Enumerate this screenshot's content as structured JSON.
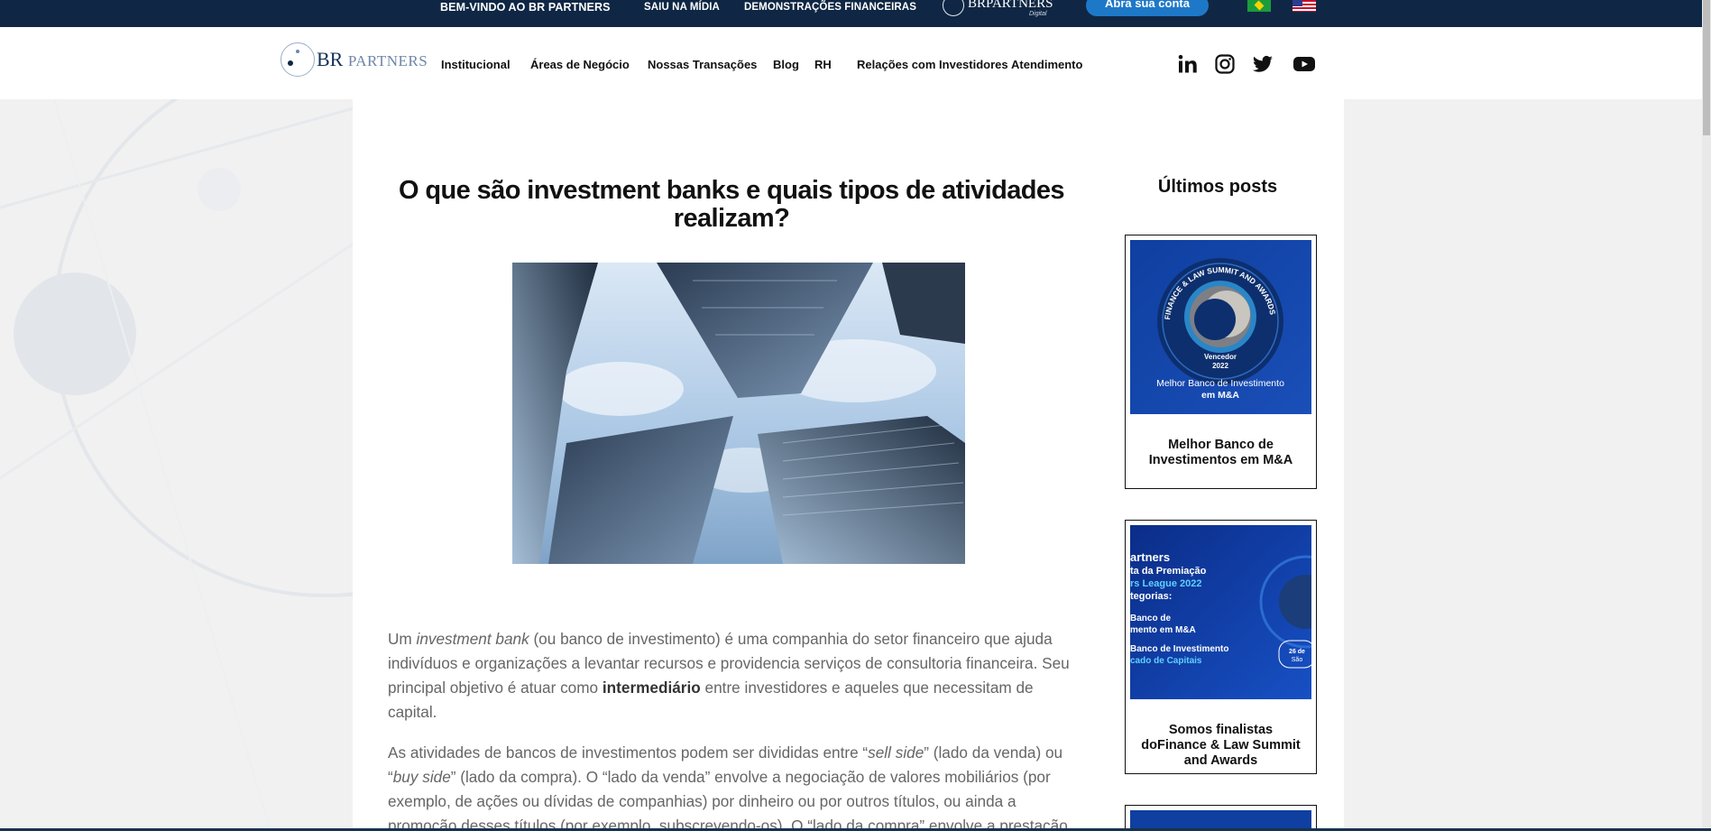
{
  "topbar": {
    "welcome": "BEM-VINDO AO BR PARTNERS",
    "midia": "SAIU NA MÍDIA",
    "demonstracoes": "DEMONSTRAÇÕES FINANCEIRAS",
    "digital_logo": "BRPARTNERS",
    "digital_sub": "Digital",
    "account_button": "Abra sua conta",
    "flag_br": "flag-brazil-icon",
    "flag_us": "flag-usa-icon"
  },
  "header": {
    "logo_main": "BR",
    "logo_rest": "PARTNERS",
    "nav": [
      "Institucional",
      "Áreas de Negócio",
      "Nossas Transações",
      "Blog",
      "RH",
      "Relações com Investidores",
      "Atendimento"
    ],
    "social": [
      "linkedin-icon",
      "instagram-icon",
      "twitter-icon",
      "youtube-icon"
    ]
  },
  "article": {
    "title": "O que são investment banks e quais tipos de atividades realizam?",
    "p1": {
      "a": "Um ",
      "b": "investment bank",
      "c": " (ou banco de investimento) é uma companhia do setor financeiro que ajuda indivíduos e organizações a levantar recursos e providencia serviços de consultoria financeira. Seu principal objetivo é atuar como ",
      "d": "intermediário",
      "e": " entre investidores e aqueles que necessitam de capital."
    },
    "p2": {
      "a": "As atividades de bancos de investimentos podem ser divididas entre “",
      "b": "sell side",
      "c": "” (lado da venda) ou “",
      "d": "buy side",
      "e": "” (lado da compra). O “lado da venda” envolve a negociação de valores mobiliários (por exemplo, de ações ou dívidas de companhias) por dinheiro ou por outros títulos, ou ainda a promoção desses títulos (por exemplo, subscrevendo-os). O “lado da compra” envolve a prestação"
    }
  },
  "sidebar": {
    "title": "Últimos posts",
    "posts": [
      {
        "title": "Melhor Banco de Investimentos em M&A",
        "badge_ring": "FINANCE & LAW SUMMIT AND AWARDS",
        "badge_winner": "Vencedor",
        "badge_year": "2022",
        "badge_line1": "Melhor Banco de Investimento",
        "badge_line2": "em M&A"
      },
      {
        "title": "Somos finalistas doFinance & Law Summit and Awards",
        "img_lines": [
          "artners",
          "ta da Premiação",
          "rs League 2022",
          "tegorias:",
          "Banco de",
          "mento em M&A",
          "Banco de Investimento",
          "cado de Capitais",
          "26 de",
          "São"
        ]
      }
    ]
  }
}
